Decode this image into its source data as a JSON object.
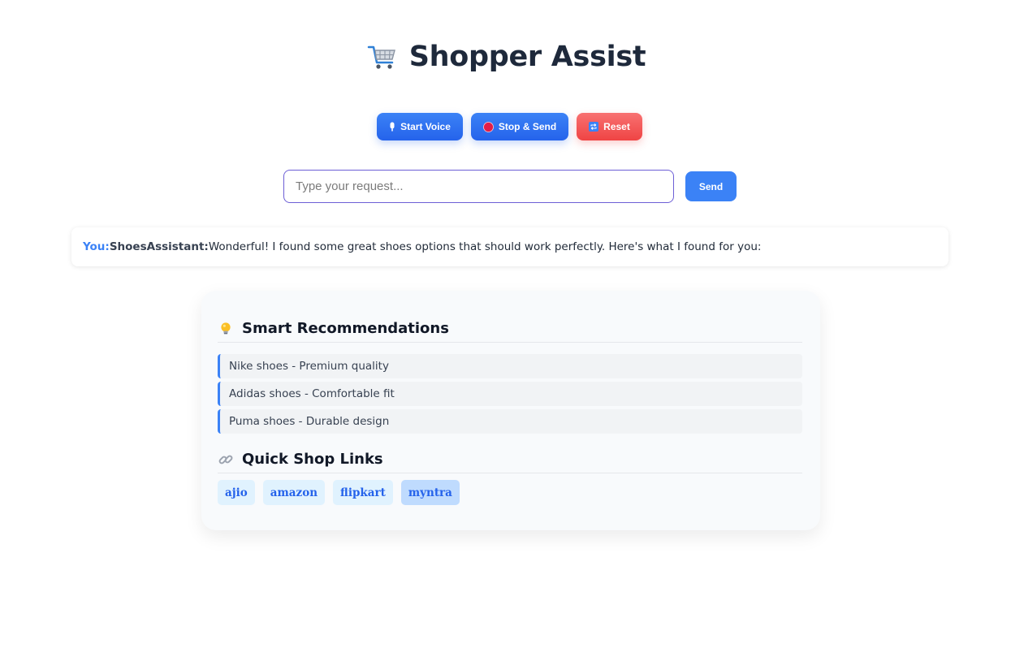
{
  "header": {
    "title": "Shopper Assist",
    "icon": "shopping-cart-icon"
  },
  "controls": {
    "start_label": "Start Voice",
    "start_icon": "microphone-icon",
    "stop_label": "Stop & Send",
    "stop_icon": "red-record-icon",
    "reset_label": "Reset",
    "reset_icon": "repeat-icon"
  },
  "search": {
    "placeholder": "Type your request...",
    "value": "",
    "send_label": "Send"
  },
  "chat": {
    "you_label": "You:",
    "assistant_label": "ShoesAssistant:",
    "message": "Wonderful! I found some great shoes options that should work perfectly. Here's what I found for you:"
  },
  "recommendations": {
    "title": "Smart Recommendations",
    "icon": "lightbulb-icon",
    "items": [
      "Nike shoes - Premium quality",
      "Adidas shoes - Comfortable fit",
      "Puma shoes - Durable design"
    ]
  },
  "quick_links": {
    "title": "Quick Shop Links",
    "icon": "link-icon",
    "links": [
      "ajio",
      "amazon",
      "flipkart",
      "myntra"
    ],
    "active_link": "myntra"
  },
  "colors": {
    "primary": "#3b82f6",
    "danger": "#ef4444",
    "heading": "#1e293b"
  }
}
